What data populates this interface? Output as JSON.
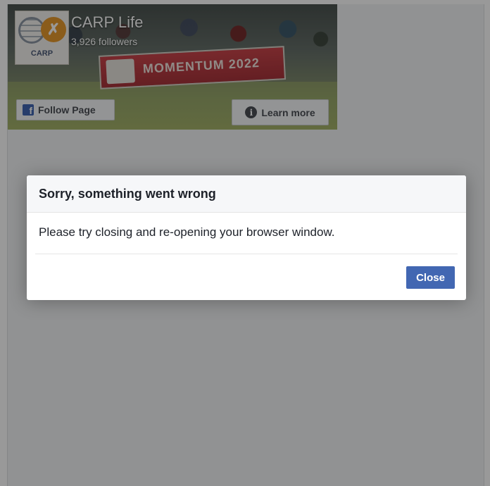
{
  "page_plugin": {
    "page_name": "CARP Life",
    "followers": "3,926 followers",
    "logo_text": "CARP",
    "banner_text": "MOMENTUM 2022",
    "follow_button": "Follow Page",
    "learn_more_button": "Learn more",
    "icons": {
      "facebook": "facebook-f-icon",
      "info": "info-icon"
    }
  },
  "dialog": {
    "title": "Sorry, something went wrong",
    "message": "Please try closing and re-opening your browser window.",
    "close_button": "Close"
  },
  "colors": {
    "accent": "#4267b2",
    "overlay": "rgba(0,0,0,0.4)",
    "dialog_header": "#f6f7f9",
    "text": "#1d2129"
  }
}
